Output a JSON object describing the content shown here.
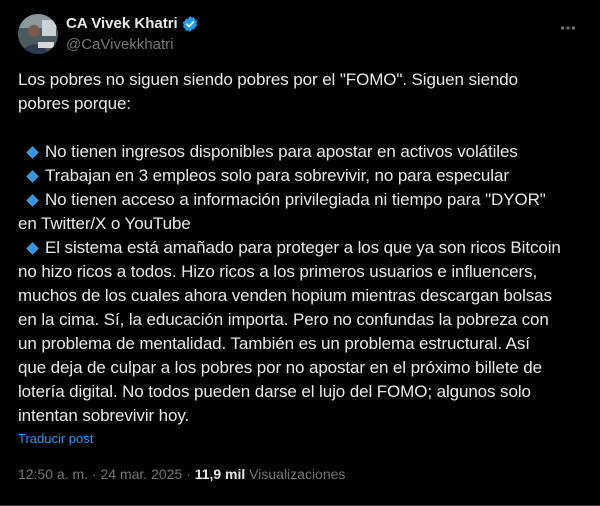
{
  "author": {
    "display_name": "CA Vivek Khatri",
    "handle": "@CaVivekkhatri",
    "verified": true
  },
  "post": {
    "intro_lines": [
      "Los pobres no siguen siendo pobres por el \"FOMO\". Siguen siendo",
      "pobres porque:"
    ],
    "bullet_lines": [
      "No tienen ingresos disponibles para apostar en activos volátiles",
      "Trabajan en 3 empleos solo para sobrevivir, no para especular",
      "No tienen acceso a información privilegiada ni tiempo para \"DYOR\""
    ],
    "bullet_3_cont": "en Twitter/X o YouTube",
    "bullet_4_line": "El sistema está amañado para proteger a los que ya son ricos Bitcoin",
    "tail_lines": [
      "no hizo ricos a todos. Hizo ricos a los primeros usuarios e influencers,",
      "muchos de los cuales ahora venden hopium mientras descargan bolsas",
      "en la cima. Sí, la educación importa. Pero no confundas la pobreza con",
      "un problema de mentalidad. También es un problema estructural. Así",
      "que deja de culpar a los pobres por no apostar en el próximo billete de",
      "lotería digital. No todos pueden darse el lujo del FOMO; algunos solo",
      "intentan sobrevivir hoy."
    ]
  },
  "translate_label": "Traducir post",
  "meta": {
    "time": "12:50 a. m.",
    "sep1": "·",
    "date": "24 mar. 2025",
    "sep2": "·",
    "views_count": "11,9 mil",
    "views_label": "Visualizaciones"
  },
  "icons": {
    "more": "more-dots-icon",
    "verified": "verified-badge-icon",
    "bullet": "blue-diamond-icon"
  },
  "colors": {
    "background": "#000000",
    "text": "#e7e9ea",
    "muted": "#71767b",
    "accent": "#1d9bf0",
    "bullet": "#3b94d9"
  }
}
